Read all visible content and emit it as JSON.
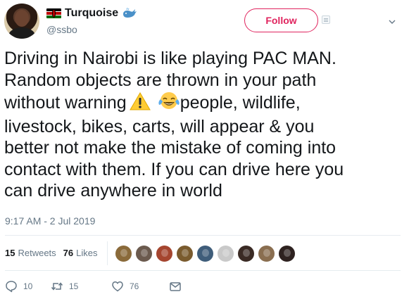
{
  "user": {
    "display_name": "Turquoise",
    "handle": "@ssbo",
    "flag_icon": "kenya-flag-icon",
    "badge_icon": "whale-icon"
  },
  "header": {
    "follow_label": "Follow"
  },
  "tweet": {
    "line1": "Driving in Nairobi is like playing PAC MAN.",
    "line2": "Random objects are thrown in your path",
    "line3a": "without warning",
    "line3b": "people, wildlife,",
    "line4": "livestock, bikes, carts, will appear & you",
    "line5": "better not make the mistake of coming into",
    "line6": "contact with them. If you can drive here you",
    "line7": "can drive anywhere in world",
    "emojis": [
      "warning-icon",
      "tears-of-joy-icon"
    ],
    "timestamp": "9:17 AM - 2 Jul 2019"
  },
  "stats": {
    "retweets_count": "15",
    "retweets_label": "Retweets",
    "likes_count": "76",
    "likes_label": "Likes"
  },
  "likers": [
    {
      "color": "#8a6a3a"
    },
    {
      "color": "#6b5a4e"
    },
    {
      "color": "#a5452f"
    },
    {
      "color": "#7a5b2e"
    },
    {
      "color": "#3f5d7a"
    },
    {
      "color": "#c9c9c9"
    },
    {
      "color": "#3a2a24"
    },
    {
      "color": "#8a6e50"
    },
    {
      "color": "#2e2220"
    }
  ],
  "actions": {
    "reply_count": "10",
    "retweet_count": "15",
    "like_count": "76"
  },
  "colors": {
    "accent_pink": "#e0245e",
    "muted": "#657786",
    "text": "#14171a"
  }
}
